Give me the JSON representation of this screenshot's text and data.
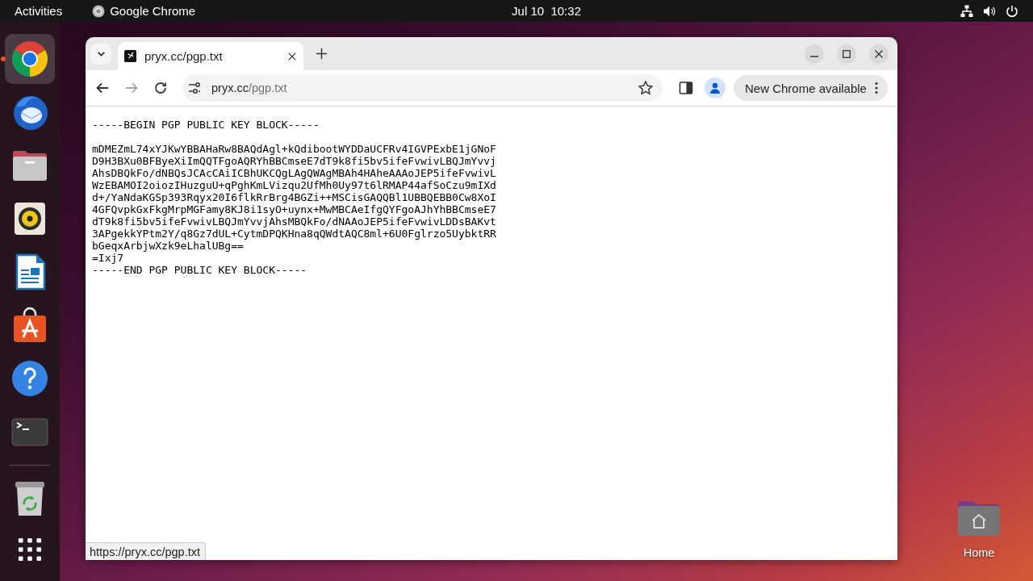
{
  "top_bar": {
    "activities": "Activities",
    "app_menu": "Google Chrome",
    "clock": "Jul 10  10:32"
  },
  "dock": {
    "favorites": [
      {
        "kind": "browser",
        "running": true,
        "focused": true
      },
      {
        "kind": "mail",
        "running": false,
        "focused": false
      },
      {
        "kind": "files",
        "running": false,
        "focused": false
      },
      {
        "kind": "music",
        "running": false,
        "focused": false
      },
      {
        "kind": "writer",
        "running": false,
        "focused": false
      },
      {
        "kind": "store",
        "running": false,
        "focused": false
      },
      {
        "kind": "help",
        "running": false,
        "focused": false
      },
      {
        "kind": "terminal",
        "running": false,
        "focused": false
      }
    ],
    "others": [
      {
        "kind": "trash",
        "running": false,
        "focused": false
      }
    ]
  },
  "browser": {
    "tabs": [
      {
        "title": "pryx.cc/pgp.txt",
        "selected": true
      }
    ],
    "nav_buttons": [
      {
        "kind": "back",
        "disabled": false
      },
      {
        "kind": "forward",
        "disabled": true
      },
      {
        "kind": "reload",
        "disabled": false
      }
    ],
    "address": {
      "host": "pryx.cc",
      "path": "/pgp.txt"
    },
    "update_chip": "New Chrome available",
    "page": {
      "begin_line": "-----BEGIN PGP PUBLIC KEY BLOCK-----",
      "key_lines": [
        "mDMEZmL74xYJKwYBBAHaRw8BAQdAgl+kQdibootWYDDaUCFRv4IGVPExbE1jGNoF",
        "D9H3BXu0BFByeXiImQQTFgoAQRYhBBCmseE7dT9k8fi5bv5ifeFvwivLBQJmYvvj",
        "AhsDBQkFo/dNBQsJCAcCAiICBhUKCQgLAgQWAgMBAh4HAheAAAoJEP5ifeFvwivL",
        "WzEBAMOI2oiozIHuzguU+qPghKmLVizqu2UfMh0Uy97t6lRMAP44afSoCzu9mIXd",
        "d+/YaNdaKGSp393Rqyx20I6flkRrBrg4BGZi++MSCisGAQQBl1UBBQEBB0Cw8XoI",
        "4GFQvpkGxFkgMrpMGFamy8KJ8i1syO+uynx+MwMBCAeIfgQYFgoAJhYhBBCmseE7",
        "dT9k8fi5bv5ifeFvwivLBQJmYvvjAhsMBQkFo/dNAAoJEP5ifeFvwivLDDsBAKvt",
        "3APgekkYPtm2Y/q8Gz7dUL+CytmDPQKHna8qQWdtAQC8ml+6U0Fglrzo5UybktRR",
        "bGeqxArbjwXzk9eLhalUBg=="
      ],
      "checksum_line": "=Ixj7",
      "end_line": "-----END PGP PUBLIC KEY BLOCK-----"
    },
    "status_url": "https://pryx.cc/pgp.txt"
  },
  "desktop": {
    "icons": [
      {
        "label": "Home"
      }
    ]
  }
}
